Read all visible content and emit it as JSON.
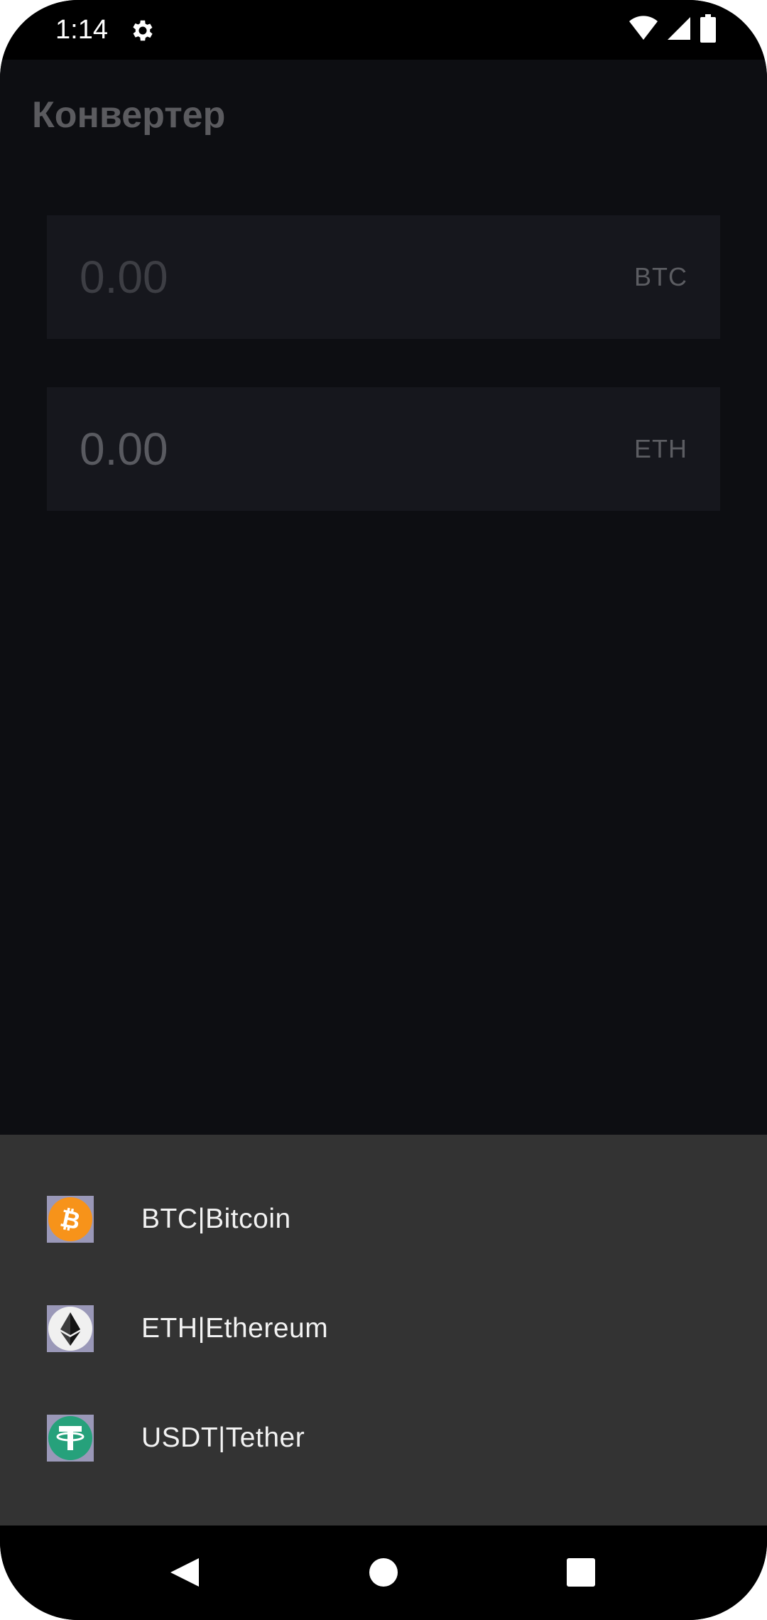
{
  "status_bar": {
    "time": "1:14",
    "icons": [
      "settings-icon",
      "wifi-icon",
      "signal-icon",
      "battery-icon"
    ]
  },
  "app": {
    "title": "Конвертер"
  },
  "converter": {
    "fields": [
      {
        "value": "0.00",
        "code": "BTC"
      },
      {
        "value": "0.00",
        "code": "ETH"
      }
    ]
  },
  "sheet": {
    "items": [
      {
        "label": "BTC|Bitcoin",
        "icon": "bitcoin-icon",
        "color": "#f7931a"
      },
      {
        "label": "ETH|Ethereum",
        "icon": "ethereum-icon",
        "color": "#3c3c3d"
      },
      {
        "label": "USDT|Tether",
        "icon": "tether-icon",
        "color": "#26a17b"
      }
    ]
  },
  "nav": {
    "icons": [
      "back-icon",
      "home-icon",
      "recents-icon"
    ]
  }
}
